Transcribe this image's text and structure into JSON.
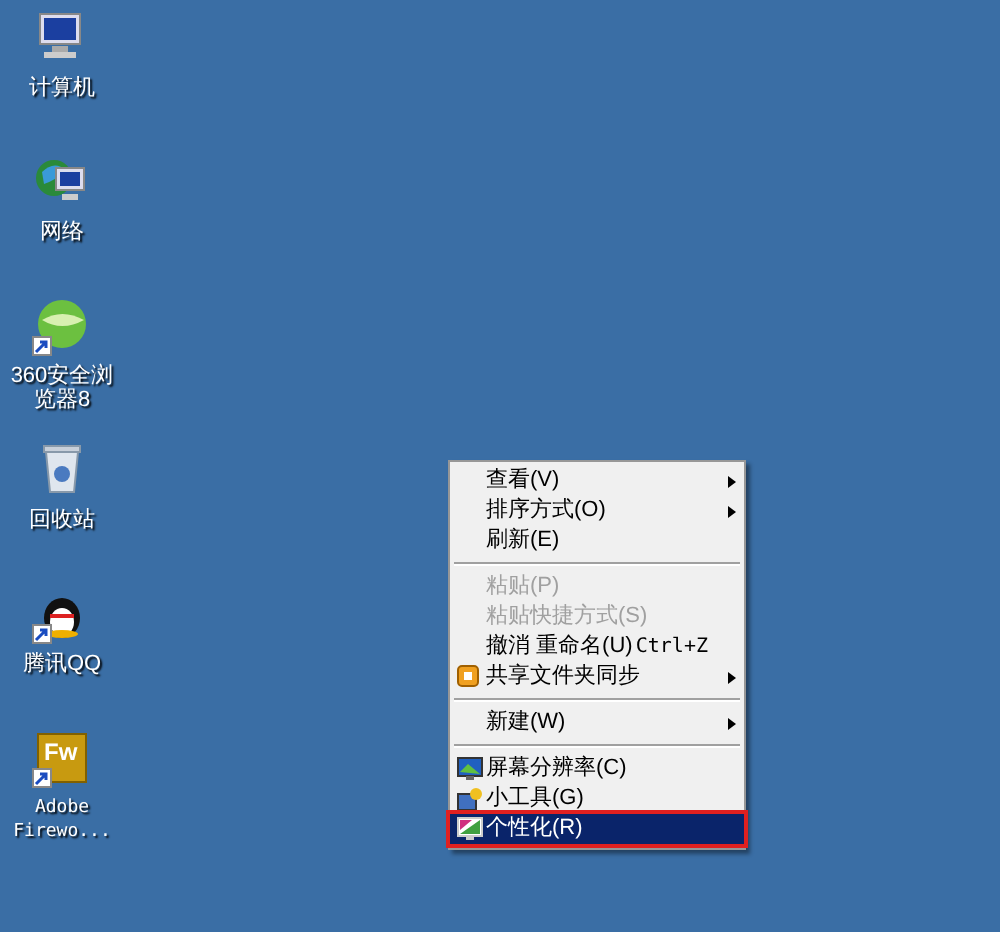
{
  "desktop_icons": [
    {
      "label": "计算机",
      "kind": "computer",
      "shortcut": false
    },
    {
      "label": "网络",
      "kind": "network",
      "shortcut": false
    },
    {
      "label": "360安全浏览器8",
      "kind": "browser",
      "shortcut": true
    },
    {
      "label": "回收站",
      "kind": "recycle-bin",
      "shortcut": false
    },
    {
      "label": "腾讯QQ",
      "kind": "penguin",
      "shortcut": true
    },
    {
      "label": "Adobe Firewo...",
      "kind": "fw",
      "shortcut": true,
      "badge": "Fw"
    }
  ],
  "context_menu": {
    "items": [
      {
        "kind": "item",
        "label": "查看(V)",
        "disabled": false,
        "submenu": true,
        "selected": false
      },
      {
        "kind": "item",
        "label": "排序方式(O)",
        "disabled": false,
        "submenu": true,
        "selected": false
      },
      {
        "kind": "item",
        "label": "刷新(E)",
        "disabled": false,
        "submenu": false,
        "selected": false
      },
      {
        "kind": "separator"
      },
      {
        "kind": "item",
        "label": "粘贴(P)",
        "disabled": true,
        "submenu": false,
        "selected": false
      },
      {
        "kind": "item",
        "label": "粘贴快捷方式(S)",
        "disabled": true,
        "submenu": false,
        "selected": false
      },
      {
        "kind": "item",
        "label": "撤消 重命名(U)",
        "shortcut": "Ctrl+Z",
        "disabled": false,
        "submenu": false,
        "selected": false
      },
      {
        "kind": "item",
        "label": "共享文件夹同步",
        "disabled": false,
        "submenu": true,
        "selected": false
      },
      {
        "kind": "separator"
      },
      {
        "kind": "item",
        "label": "新建(W)",
        "disabled": false,
        "submenu": true,
        "selected": false
      },
      {
        "kind": "separator"
      },
      {
        "kind": "item",
        "label": "屏幕分辨率(C)",
        "disabled": false,
        "submenu": false,
        "selected": false
      },
      {
        "kind": "item",
        "label": "小工具(G)",
        "disabled": false,
        "submenu": false,
        "selected": false
      },
      {
        "kind": "item",
        "label": "个性化(R)",
        "disabled": false,
        "submenu": false,
        "selected": true,
        "annotated": true
      }
    ]
  }
}
